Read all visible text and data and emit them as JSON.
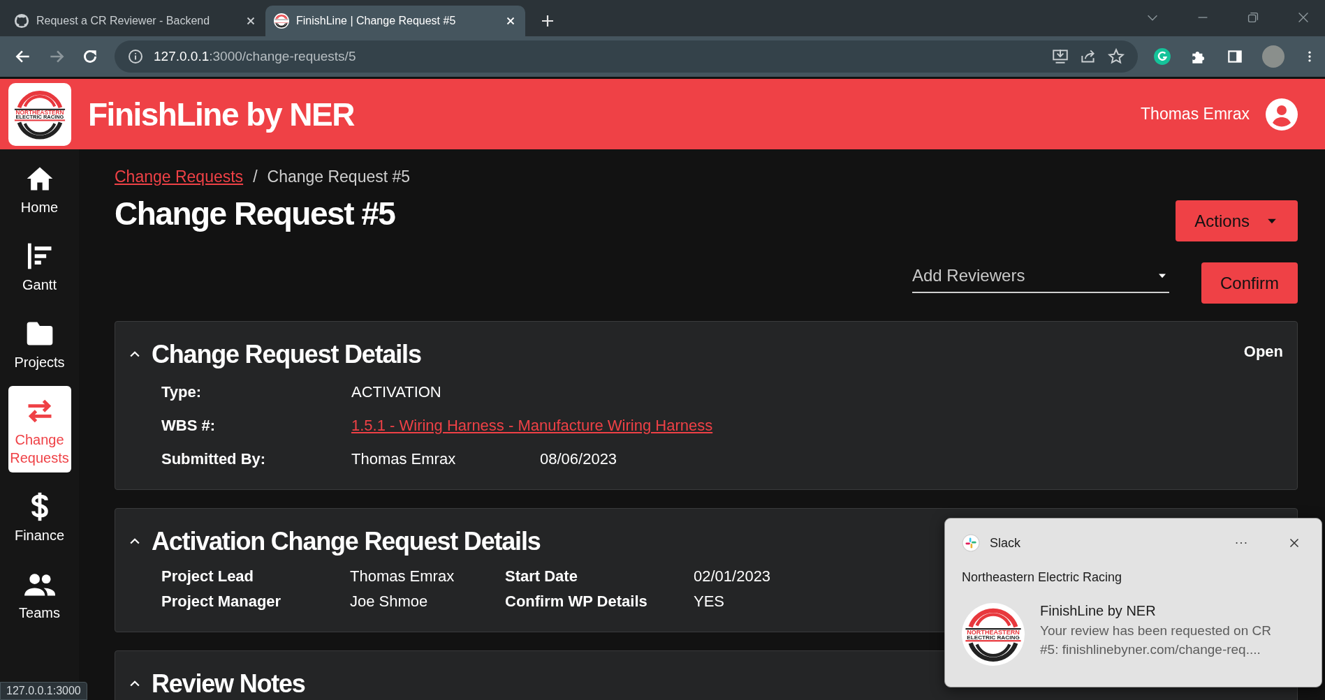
{
  "browser": {
    "tabs": [
      {
        "title": "Request a CR Reviewer - Backend",
        "selected": false
      },
      {
        "title": "FinishLine | Change Request #5",
        "selected": true
      }
    ],
    "url": {
      "host": "127.0.0.1",
      "path": ":3000/change-requests/5"
    }
  },
  "header": {
    "logo": [
      "NORTHEASTERN",
      "ELECTRIC RACING"
    ],
    "title": "FinishLine by NER",
    "user_name": "Thomas Emrax"
  },
  "sidebar": {
    "items": [
      {
        "label": "Home",
        "selected": false
      },
      {
        "label": "Gantt",
        "selected": false
      },
      {
        "label": "Projects",
        "selected": false
      },
      {
        "label": "Change Requests",
        "selected": true
      },
      {
        "label": "Finance",
        "selected": false
      },
      {
        "label": "Teams",
        "selected": false
      }
    ]
  },
  "breadcrumb": {
    "separator": "/",
    "items": [
      {
        "label": "Change Requests",
        "kind": "link"
      },
      {
        "label": "Change Request #5",
        "kind": "current"
      }
    ]
  },
  "page": {
    "title": "Change Request #5",
    "actions_button": "Actions",
    "reviewers_select": {
      "placeholder": "Add Reviewers"
    },
    "confirm_button": "Confirm"
  },
  "sections": [
    {
      "title": "Change Request Details",
      "expanded": true,
      "status": "Open",
      "kind": "list",
      "fields": [
        {
          "label": "Type:",
          "values": [
            "ACTIVATION"
          ],
          "kind": "text"
        },
        {
          "label": "WBS #:",
          "values": [
            "1.5.1 - Wiring Harness - Manufacture Wiring Harness"
          ],
          "kind": "link"
        },
        {
          "label": "Submitted By:",
          "values": [
            "Thomas Emrax",
            "08/06/2023"
          ],
          "kind": "text"
        }
      ]
    },
    {
      "title": "Activation Change Request Details",
      "expanded": true,
      "kind": "grid",
      "fields": [
        {
          "label": "Project Lead",
          "values": [
            "Thomas Emrax"
          ]
        },
        {
          "label": "Start Date",
          "values": [
            "02/01/2023"
          ]
        },
        {
          "label": "Project Manager",
          "values": [
            "Joe Shmoe"
          ]
        },
        {
          "label": "Confirm WP Details",
          "values": [
            "YES"
          ]
        }
      ]
    },
    {
      "title": "Review Notes",
      "expanded": true,
      "kind": "list"
    }
  ],
  "notification": {
    "app": "Slack",
    "account": "Northeastern Electric Racing",
    "avatar_logo": [
      "NORTHEASTERN",
      "ELECTRIC RACING"
    ],
    "title": "FinishLine by NER",
    "body": "Your review has been requested on CR #5: finishlinebyner.com/change-req...."
  },
  "status_url": "127.0.0.1:3000"
}
